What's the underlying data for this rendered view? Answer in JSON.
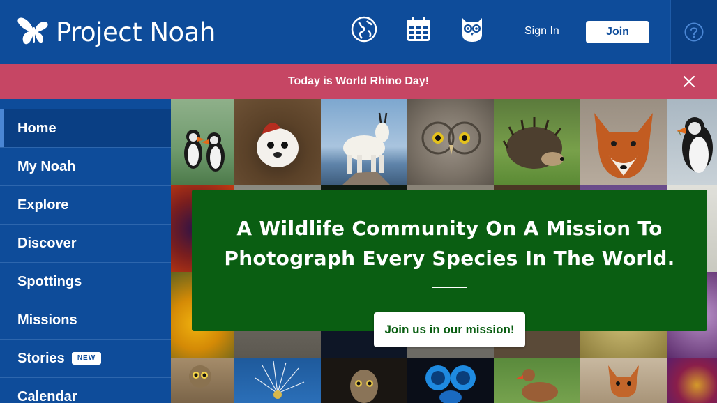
{
  "header": {
    "logo_text": "Project Noah",
    "icons": [
      "globe-icon",
      "calendar-icon",
      "owl-icon",
      "help-icon"
    ],
    "sign_in": "Sign In",
    "join": "Join",
    "bg_color": "#0e4c9a"
  },
  "banner": {
    "text": "Today is World Rhino Day!",
    "bg_color": "#c64664"
  },
  "sidebar": {
    "items": [
      {
        "label": "Home",
        "active": true
      },
      {
        "label": "My Noah"
      },
      {
        "label": "Explore"
      },
      {
        "label": "Discover"
      },
      {
        "label": "Spottings"
      },
      {
        "label": "Missions"
      },
      {
        "label": "Stories",
        "badge": "NEW"
      },
      {
        "label": "Calendar"
      }
    ]
  },
  "mission": {
    "line1": "A Wildlife Community On A Mission To",
    "line2": "Photograph Every Species In The World.",
    "button": "Join us in our mission!",
    "bg_color": "#0a5e12"
  },
  "mosaic": {
    "tiles": [
      "puffins",
      "tree-squirrel",
      "mountain-goat",
      "owl",
      "hedgehog",
      "red-fox",
      "puffin",
      "flower",
      "orchid",
      "snail",
      "owl-small",
      "dandelion",
      "saw-whet-owl",
      "blue-beetle",
      "duck",
      "fox-cub",
      "passionflower"
    ]
  }
}
